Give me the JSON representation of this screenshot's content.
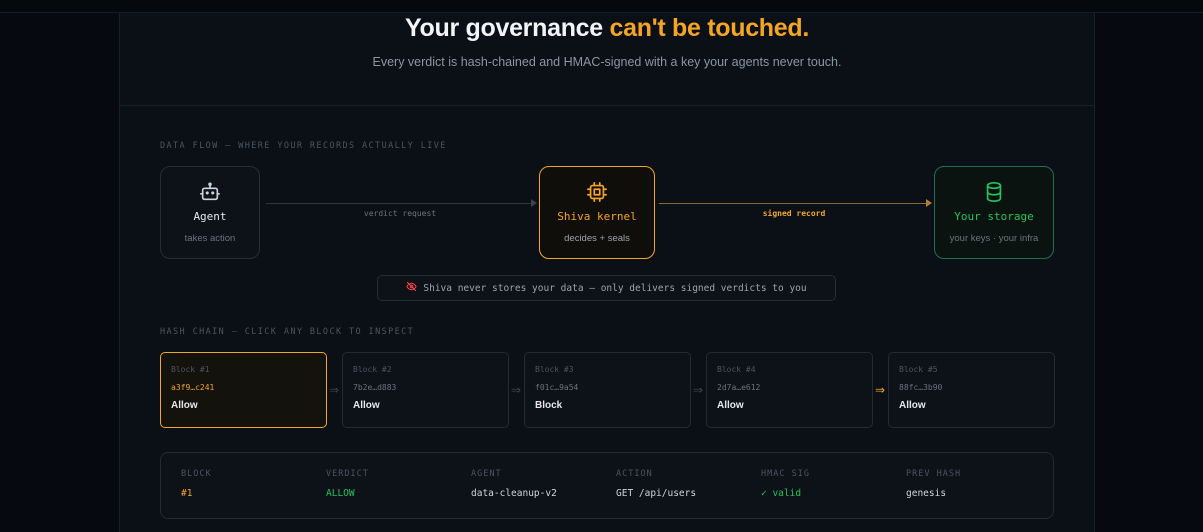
{
  "hero": {
    "title_main": "Your governance ",
    "title_accent": "can't be touched.",
    "subtitle": "Every verdict is hash-chained and HMAC-signed with a key your agents never touch."
  },
  "data_flow": {
    "label": "DATA FLOW — WHERE YOUR RECORDS ACTUALLY LIVE",
    "nodes": [
      {
        "title": "Agent",
        "sub": "takes action",
        "icon": "robot-icon"
      },
      {
        "title": "Shiva kernel",
        "sub": "decides + seals",
        "icon": "cpu-chip-icon"
      },
      {
        "title": "Your storage",
        "sub": "your keys · your infra",
        "icon": "database-icon"
      }
    ],
    "edge1_label": "verdict request",
    "edge2_label": "signed record",
    "notice": "Shiva never stores your data — only delivers signed verdicts to you",
    "colors": {
      "accent": "#f5a524",
      "storage": "#22c55e"
    }
  },
  "hash_chain": {
    "label": "HASH CHAIN — CLICK ANY BLOCK TO INSPECT",
    "blocks": [
      {
        "label": "Block #1",
        "hash": "a3f9…c241",
        "verdict": "Allow"
      },
      {
        "label": "Block #2",
        "hash": "7b2e…d883",
        "verdict": "Allow"
      },
      {
        "label": "Block #3",
        "hash": "f01c…9a54",
        "verdict": "Block"
      },
      {
        "label": "Block #4",
        "hash": "2d7a…e612",
        "verdict": "Allow"
      },
      {
        "label": "Block #5",
        "hash": "88fc…3b90",
        "verdict": "Allow"
      }
    ],
    "arrow": "⇒",
    "selected_index": 0
  },
  "detail": {
    "headers": [
      "BLOCK",
      "VERDICT",
      "AGENT",
      "ACTION",
      "HMAC SIG",
      "PREV HASH"
    ],
    "values": [
      "#1",
      "ALLOW",
      "data-cleanup-v2",
      "GET /api/users",
      "✓ valid",
      "genesis"
    ]
  }
}
